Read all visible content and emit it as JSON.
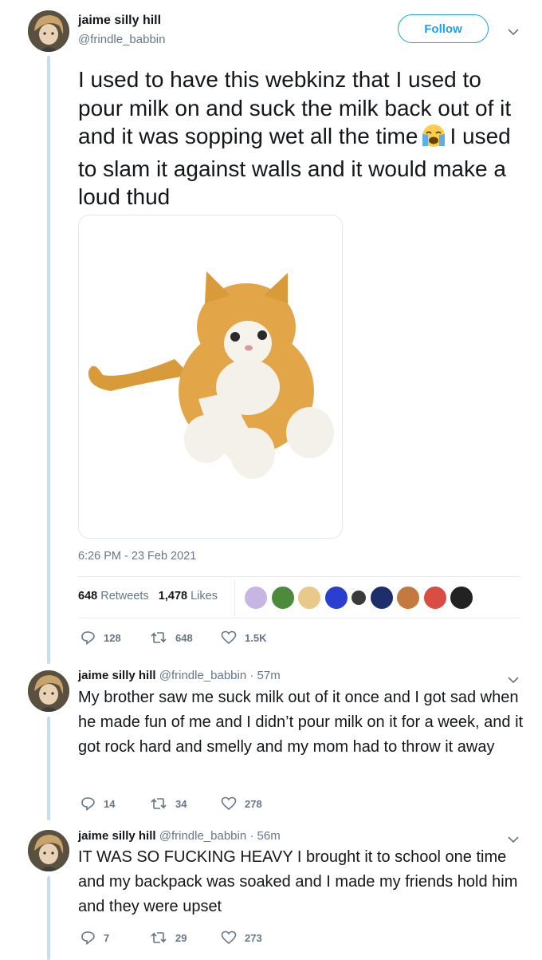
{
  "main_tweet": {
    "author_name": "jaime silly hill",
    "author_handle": "@frindle_babbin",
    "follow_label": "Follow",
    "text_part1": "I used to have this webkinz that I used to pour milk on and suck the milk back out of it and it was sopping wet all the time",
    "text_part2": "I used to slam it against walls and it would make a loud thud",
    "emoji": "loudly-crying-face-emoji",
    "timestamp": "6:26 PM - 23 Feb 2021",
    "retweets_count": "648",
    "retweets_label": "Retweets",
    "likes_count": "1,478",
    "likes_label": "Likes",
    "actions": {
      "replies": "128",
      "retweets": "648",
      "likes": "1.5K"
    }
  },
  "replies": [
    {
      "author_name": "jaime silly hill",
      "author_handle": "@frindle_babbin",
      "time": "· 57m",
      "text": "My brother saw me suck milk out of it once and I got sad when he made fun of me and I didn’t pour milk on it for a week, and it got rock hard and smelly and my mom had to throw it away",
      "actions": {
        "replies": "14",
        "retweets": "34",
        "likes": "278"
      }
    },
    {
      "author_name": "jaime silly hill",
      "author_handle": "@frindle_babbin",
      "time": "· 56m",
      "text": "IT WAS SO FUCKING HEAVY I brought it to school one time and my backpack was soaked and I made my friends hold him and they were upset",
      "actions": {
        "replies": "7",
        "retweets": "29",
        "likes": "273"
      }
    }
  ],
  "colors": {
    "accent": "#1da1f2",
    "thread_line": "#c2dff3",
    "secondary_text": "#657786"
  }
}
